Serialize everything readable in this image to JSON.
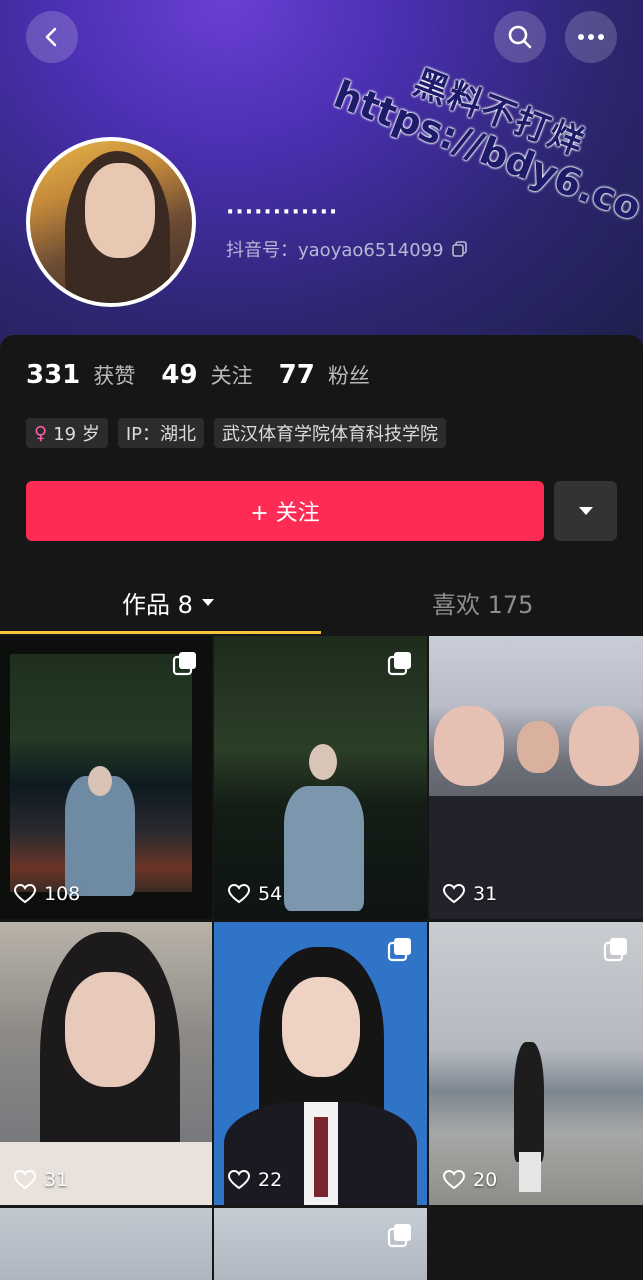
{
  "header": {
    "back_icon": "chevron-left-icon",
    "search_icon": "search-icon",
    "more_icon": "more-horizontal-icon"
  },
  "watermark": {
    "line1": "黑料不打烊",
    "line2": "https://bdy6.co"
  },
  "profile": {
    "nickname": "············",
    "douyin_id": "抖音号：yaoyao6514099",
    "copy_icon": "copy-icon"
  },
  "stats": [
    {
      "num": "331",
      "label": "获赞"
    },
    {
      "num": "49",
      "label": "关注"
    },
    {
      "num": "77",
      "label": "粉丝"
    }
  ],
  "tags": {
    "age": "19 岁",
    "ip": "IP：湖北",
    "school": "武汉体育学院体育科技学院"
  },
  "follow_button": "+ 关注",
  "tabs": {
    "works": "作品 8",
    "likes": "喜欢 175"
  },
  "colors": {
    "accent": "#fe2c55",
    "tab_indicator": "#f7c33c",
    "background": "#161616"
  },
  "videos": [
    {
      "likes": "108",
      "multi": true
    },
    {
      "likes": "54",
      "multi": true
    },
    {
      "likes": "31",
      "multi": false
    },
    {
      "likes": "31",
      "multi": false
    },
    {
      "likes": "22",
      "multi": true
    },
    {
      "likes": "20",
      "multi": true
    },
    {
      "likes": "",
      "multi": false
    },
    {
      "likes": "",
      "multi": true
    }
  ]
}
